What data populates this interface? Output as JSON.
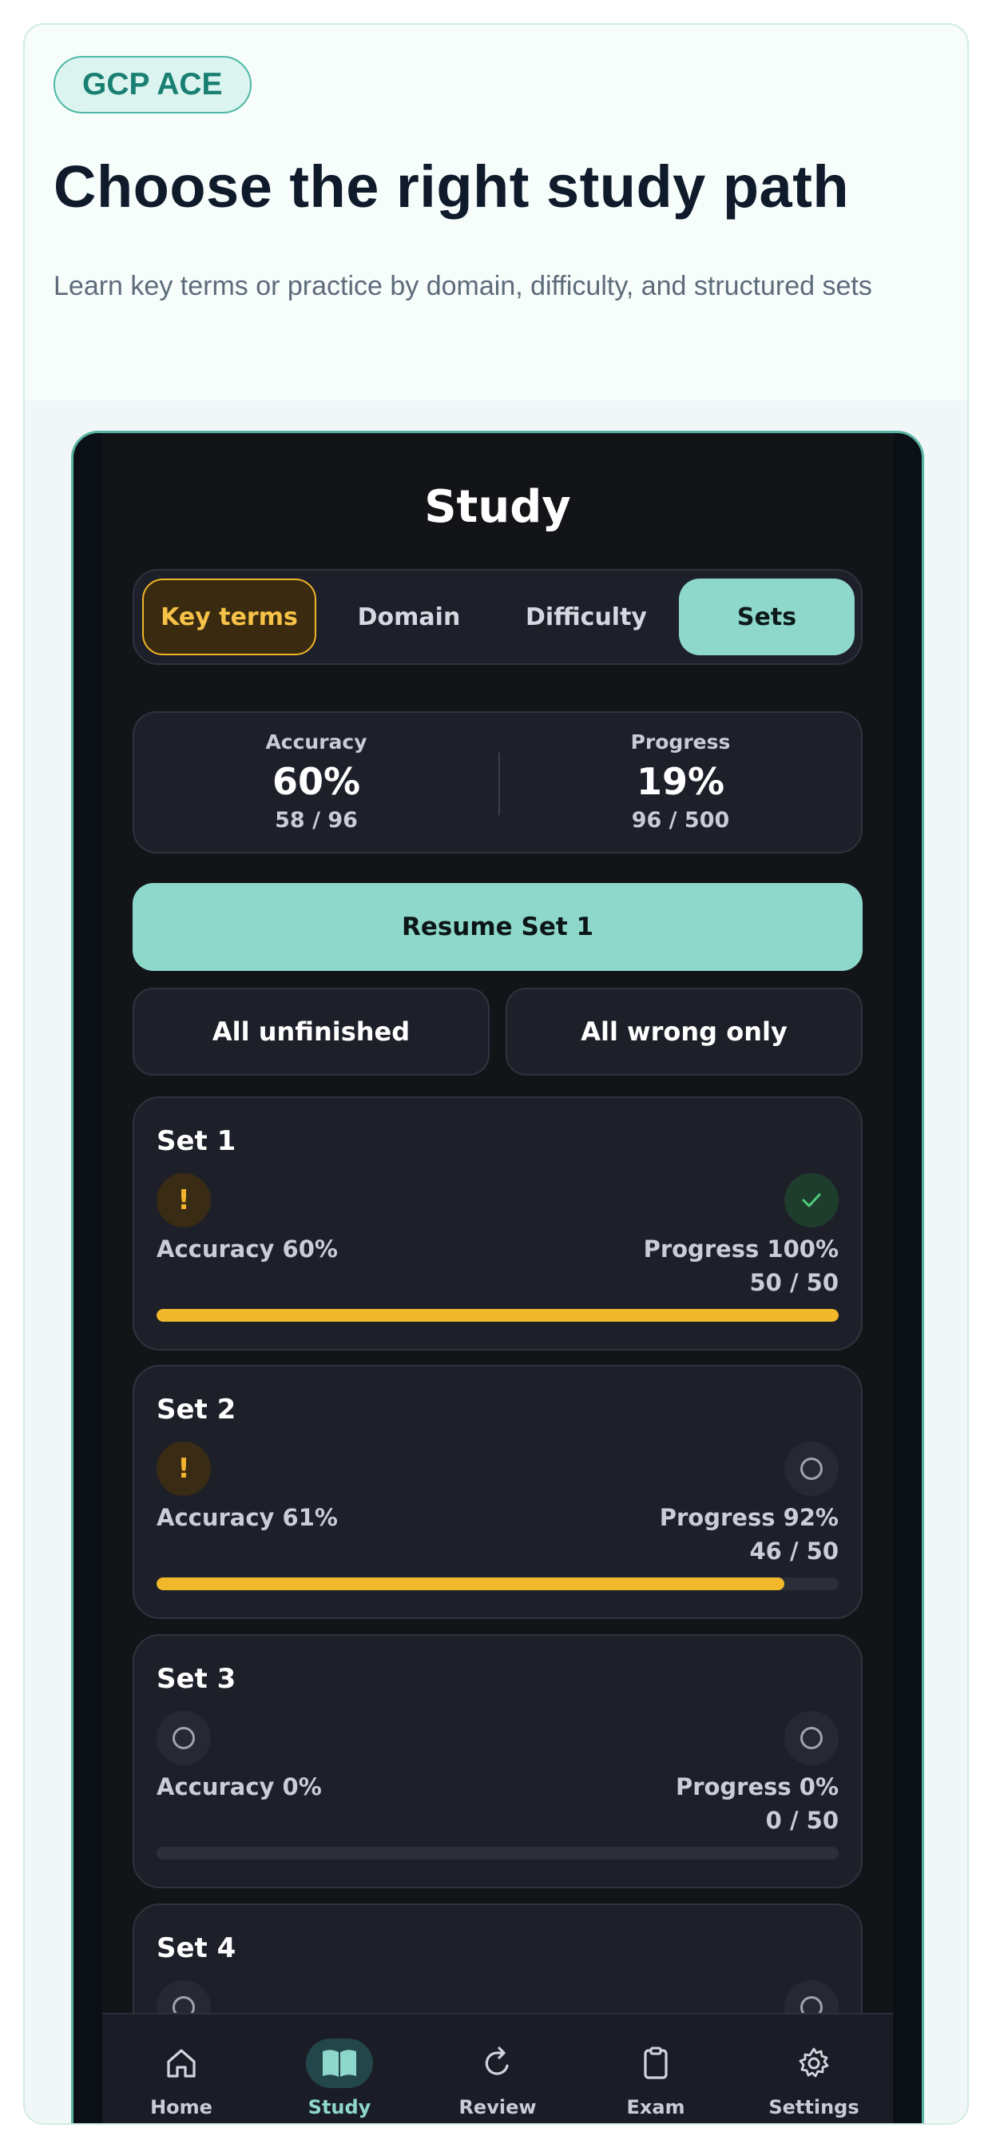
{
  "hero": {
    "tag": "GCP ACE",
    "title": "Choose the right study path",
    "subtitle": "Learn key terms or practice by domain, difficulty, and structured sets"
  },
  "screen": {
    "title": "Study",
    "segments": [
      {
        "label": "Key terms",
        "state": "highlighted"
      },
      {
        "label": "Domain",
        "state": "default"
      },
      {
        "label": "Difficulty",
        "state": "default"
      },
      {
        "label": "Sets",
        "state": "selected"
      }
    ],
    "stats": {
      "accuracy": {
        "label": "Accuracy",
        "value": "60%",
        "sub": "58 / 96"
      },
      "progress": {
        "label": "Progress",
        "value": "19%",
        "sub": "96 / 500"
      }
    },
    "resume_label": "Resume Set 1",
    "all_unfinished_label": "All unfinished",
    "all_wrong_label": "All wrong only",
    "sets": [
      {
        "title": "Set 1",
        "left_badge": "warning",
        "left_glyph": "!",
        "right_badge": "check-icon",
        "accuracy": "Accuracy 60%",
        "progress": "Progress 100%",
        "count": "50 / 50",
        "fill": 1.0
      },
      {
        "title": "Set 2",
        "left_badge": "warning",
        "left_glyph": "!",
        "right_badge": "empty-circle-icon",
        "accuracy": "Accuracy 61%",
        "progress": "Progress 92%",
        "count": "46 / 50",
        "fill": 0.92
      },
      {
        "title": "Set 3",
        "left_badge": "empty-circle-icon",
        "right_badge": "empty-circle-icon",
        "accuracy": "Accuracy 0%",
        "progress": "Progress 0%",
        "count": "0 / 50",
        "fill": 0.0
      },
      {
        "title": "Set 4",
        "left_badge": "empty-circle-icon",
        "right_badge": "empty-circle-icon"
      }
    ]
  },
  "tabs": [
    {
      "label": "Home",
      "icon": "home-icon",
      "active": false
    },
    {
      "label": "Study",
      "icon": "book-icon",
      "active": true
    },
    {
      "label": "Review",
      "icon": "refresh-icon",
      "active": false
    },
    {
      "label": "Exam",
      "icon": "clipboard-icon",
      "active": false
    },
    {
      "label": "Settings",
      "icon": "gear-icon",
      "active": false
    }
  ],
  "colors": {
    "accent": "#8dd7cb",
    "warning": "#f2b82c",
    "success": "#4ecb7a",
    "background": "#131417",
    "card": "#1d1f29"
  }
}
